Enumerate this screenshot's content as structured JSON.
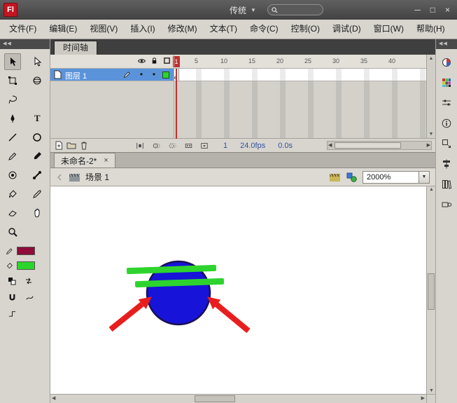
{
  "titlebar": {
    "logo": "Fl",
    "workspace": "传统",
    "minimize": "─",
    "maximize": "□",
    "close": "×"
  },
  "menubar": {
    "items": [
      "文件(F)",
      "编辑(E)",
      "视图(V)",
      "插入(I)",
      "修改(M)",
      "文本(T)",
      "命令(C)",
      "控制(O)",
      "调试(D)",
      "窗口(W)",
      "帮助(H)"
    ]
  },
  "docks": {
    "left_collapse": "◀◀",
    "right_collapse": "◀◀"
  },
  "timeline": {
    "tab_label": "时间轴",
    "layers": [
      {
        "name": "图层 1"
      }
    ],
    "ruler": {
      "playhead_frame": "1",
      "ticks": [
        "5",
        "10",
        "15",
        "20",
        "25",
        "30",
        "35",
        "40"
      ]
    },
    "status": {
      "current_frame": "1",
      "frame_rate": "24.0fps",
      "elapsed_time": "0.0s"
    }
  },
  "documents": {
    "tabs": [
      {
        "label": "未命名-2*",
        "close_glyph": "×"
      }
    ]
  },
  "editbar": {
    "scene_label": "场景 1",
    "zoom_value": "2000%"
  },
  "icons": {
    "dropdown_arrow": "▼",
    "scroll_left": "◀",
    "scroll_right": "▶",
    "scroll_up": "▲",
    "scroll_down": "▼",
    "layer_visible_dot": "•",
    "layer_lock_dot": "•",
    "text_tool_glyph": "T"
  },
  "colors": {
    "stroke_swatch": "#8e0b3a",
    "fill_swatch": "#2bd52b",
    "layer_outline_swatch": "#2bd52b",
    "layer_selected": "#5b93da",
    "playhead_red": "#c03030",
    "circle_fill": "#1713d8",
    "circle_stroke": "#1a1155",
    "stripe_green": "#2ed42e",
    "arrow_red": "#e81e1e"
  }
}
